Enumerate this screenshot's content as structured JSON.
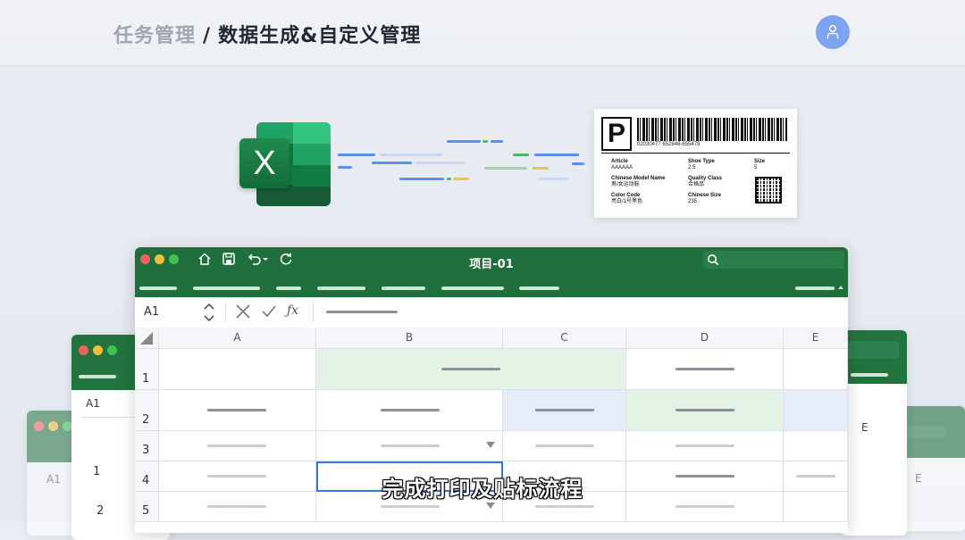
{
  "header": {
    "breadcrumb_parent": "任务管理",
    "breadcrumb_separator": "/",
    "breadcrumb_current": "数据生成&自定义管理"
  },
  "label": {
    "letter": "P",
    "barcode_number": "02030477  652848-655478",
    "fields": [
      {
        "key": "Article",
        "value": "AAAAAA"
      },
      {
        "key": "Shoe Type",
        "value": "2.5"
      },
      {
        "key": "Size",
        "value": "5"
      },
      {
        "key": "Chinese Model Name",
        "value": "男/女运动鞋"
      },
      {
        "key": "Quality Class",
        "value": "合格品"
      },
      {
        "key": "Color Code",
        "value": "亮白/1号黑色"
      },
      {
        "key": "Chinese Size",
        "value": "235"
      }
    ]
  },
  "spreadsheet": {
    "window_title": "项目-01",
    "cell_ref": "A1",
    "fx_symbol": "ƒx",
    "columns": [
      "A",
      "B",
      "C",
      "D",
      "E"
    ],
    "rows": [
      "1",
      "2",
      "3",
      "4",
      "5"
    ]
  },
  "back_windows": {
    "left_cell_ref": "A1",
    "left_rows": [
      "1",
      "2"
    ],
    "far_left_cell_ref": "A1",
    "right_col": "E",
    "far_right_col": "E"
  },
  "subtitle": "完成打印及贴标流程",
  "colors": {
    "excel_green": "#1f6f3d",
    "avatar_blue": "#7ea3f2",
    "selection_blue": "#3a78d8",
    "highlight_green": "#e3f4e7",
    "highlight_blue": "#e6ecf8"
  }
}
